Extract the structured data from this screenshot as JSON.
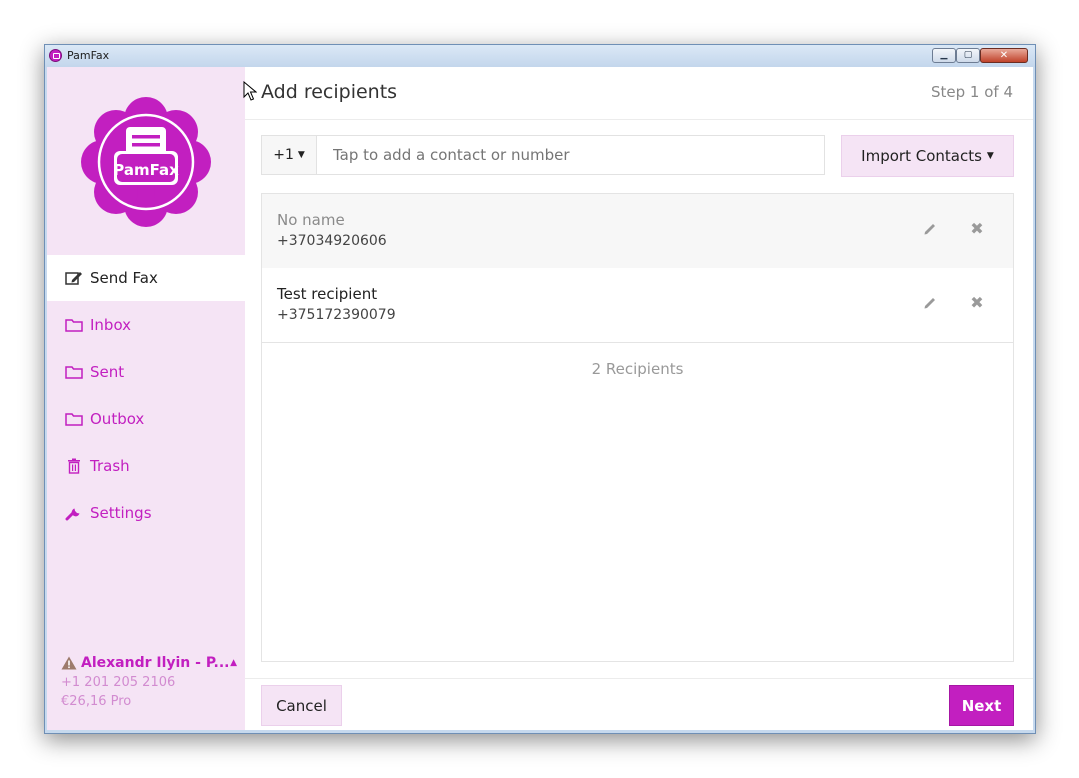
{
  "window": {
    "title": "PamFax",
    "minimize_icon": "minimize-icon",
    "maximize_icon": "maximize-icon",
    "close_icon": "close-icon"
  },
  "brand": {
    "logo_text": "PamFax",
    "color": "#c21fc0"
  },
  "sidebar": {
    "items": [
      {
        "label": "Send Fax",
        "icon": "edit-icon",
        "active": true
      },
      {
        "label": "Inbox",
        "icon": "folder-icon"
      },
      {
        "label": "Sent",
        "icon": "folder-icon"
      },
      {
        "label": "Outbox",
        "icon": "folder-icon"
      },
      {
        "label": "Trash",
        "icon": "trash-icon"
      },
      {
        "label": "Settings",
        "icon": "wrench-icon"
      }
    ],
    "account": {
      "name": "Alexandr Ilyin - P...",
      "phone": "+1 201 205 2106",
      "balance": "€26,16 Pro",
      "icon": "warning-icon"
    }
  },
  "header": {
    "title": "Add recipients",
    "step": "Step 1 of 4"
  },
  "toolbar": {
    "country_code": "+1",
    "search_placeholder": "Tap to add a contact or number",
    "search_value": "",
    "import_label": "Import Contacts"
  },
  "recipients": [
    {
      "name": "No name",
      "number": "+37034920606"
    },
    {
      "name": "Test recipient",
      "number": "+375172390079"
    }
  ],
  "recipients_count": "2 Recipients",
  "footer": {
    "cancel_label": "Cancel",
    "next_label": "Next"
  }
}
